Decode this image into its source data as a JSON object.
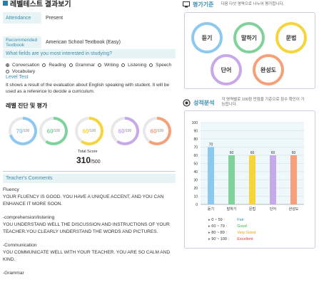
{
  "header": {
    "title": "레벨테스트 결과보기"
  },
  "info": {
    "attendance_label": "Attendance",
    "attendance_value": "Present",
    "textbook_label": "Recommended Textbook",
    "textbook_value": "American School Textbook (Easy)",
    "interest_question": "What fields are you most interested in studying?",
    "options": [
      "Conversation",
      "Reading",
      "Grammar",
      "Writing",
      "Listening",
      "Speech",
      "Vocabulary"
    ],
    "selected_option": "Conversation",
    "level_test_label": "Level Test",
    "level_test_desc": "It shows a result of the evaluation about English speaking with student. It will be used as a reference to decide a curriculum."
  },
  "level_diag": {
    "title": "레벨 진단 및 평가",
    "scores": [
      {
        "score": "70",
        "den": "/100",
        "color": "#8cc8f0",
        "percent": 70
      },
      {
        "score": "60",
        "den": "/100",
        "color": "#7fd39a",
        "percent": 60
      },
      {
        "score": "60",
        "den": "/100",
        "color": "#f5d43c",
        "percent": 60
      },
      {
        "score": "60",
        "den": "/100",
        "color": "#c7a8e8",
        "percent": 60
      },
      {
        "score": "60",
        "den": "/100",
        "color": "#f5a07a",
        "percent": 60
      }
    ],
    "total_label": "Total Score",
    "total_value": "310",
    "total_den": "/500"
  },
  "comments": {
    "title": "Teacher's Comments",
    "items": [
      {
        "heading": "Fluency",
        "text": "YOUR FLUENCY IS GOOD. YOU HAVE A UNIQUE ACCENT, AND YOU CAN ENHANCE IT MORE SOON."
      },
      {
        "heading": "-comprehension/listening",
        "text": "YOU UNDERSTAND WELL THE DISCUSSION AND INSTRUCTIONS OF YOUR TEACHER.YOU CLEARLY UNDERSTAND THE WORDS AND PICTURES."
      },
      {
        "heading": "-Communication",
        "text": "YOU COMMUNICATE WELL WITH YOUR TEACHER. YOU ARE SO CALM AND KIND."
      },
      {
        "heading": "-Grammar",
        "text": ""
      }
    ]
  },
  "criteria": {
    "title": "평가기준",
    "note": "다음 다섯 영역으로 나누어 평가합니다.",
    "items": [
      {
        "label": "듣기",
        "color": "#8cc8f0"
      },
      {
        "label": "말하기",
        "color": "#7fd39a"
      },
      {
        "label": "문법",
        "color": "#f5d43c"
      },
      {
        "label": "단어",
        "color": "#c7a8e8"
      },
      {
        "label": "완성도",
        "color": "#f5a07a"
      }
    ]
  },
  "analysis": {
    "title": "성적분석",
    "note": "각 영역별로 100점 만점을 기준으로 점수 확인이 가능합니다."
  },
  "chart_data": {
    "type": "bar",
    "categories": [
      "듣기",
      "말하기",
      "문법",
      "단어",
      "완성도"
    ],
    "values": [
      70,
      60,
      60,
      60,
      60
    ],
    "colors": [
      "#8cc8f0",
      "#7fd39a",
      "#f5d43c",
      "#c7a8e8",
      "#f5a07a"
    ],
    "ylim": [
      0,
      100
    ],
    "yticks": [
      0,
      10,
      20,
      30,
      40,
      50,
      60,
      70,
      80,
      90,
      100
    ],
    "grid": true,
    "title": "",
    "xlabel": "",
    "ylabel": ""
  },
  "legend": [
    {
      "range": "0 ~ 59 :",
      "label": "Fair",
      "color": "#3a8fb0"
    },
    {
      "range": "60 ~ 79 :",
      "label": "Good",
      "color": "#3aa84a"
    },
    {
      "range": "80 ~ 89 :",
      "label": "Very Good",
      "color": "#e8a000"
    },
    {
      "range": "90 ~ 100 :",
      "label": "Excellent",
      "color": "#e23b3b"
    }
  ]
}
